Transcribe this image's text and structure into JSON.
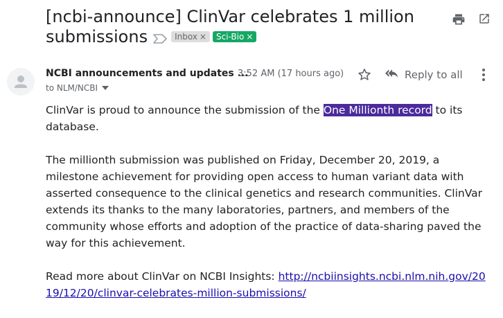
{
  "email": {
    "subject": "[ncbi-announce] ClinVar celebrates 1 million submissions",
    "labels": {
      "inbox": "Inbox",
      "scibio": "Sci-Bio",
      "remove": "×"
    },
    "sender": "NCBI announcements and updates ...",
    "time": "3:52 AM (17 hours ago)",
    "reply_all": "Reply to all",
    "to": "to NLM/NCBI",
    "body": {
      "p1_before": "ClinVar is proud to announce the submission of the ",
      "p1_highlight": "One Millionth record",
      "p1_after": " to its database.",
      "p2": "The millionth submission was published on Friday, December 20, 2019, a milestone achievement for providing open access to human variant data with asserted consequence to the clinical genetics and research communities. ClinVar extends its thanks to the many laboratories, partners, and members of the community whose efforts and adoption of the practice of data-sharing paved the way for this achievement.",
      "p3_before": "Read more about ClinVar on NCBI Insights: ",
      "link": "http://ncbiinsights.ncbi.nlm.nih.gov/2019/12/20/clinvar-celebrates-million-submissions/"
    }
  },
  "icons": {
    "important": "label-important-icon",
    "print": "print-icon",
    "open_new_window": "open-in-new-window-icon",
    "avatar": "person-avatar-icon",
    "star": "star-icon",
    "reply_all": "reply-all-icon",
    "more": "more-vert-icon",
    "dropdown": "caret-down-icon"
  },
  "colors": {
    "scibio_label": "#16a765",
    "inbox_label": "#dddddd",
    "highlight": "#4a2a9c",
    "link": "#1a0dab"
  }
}
